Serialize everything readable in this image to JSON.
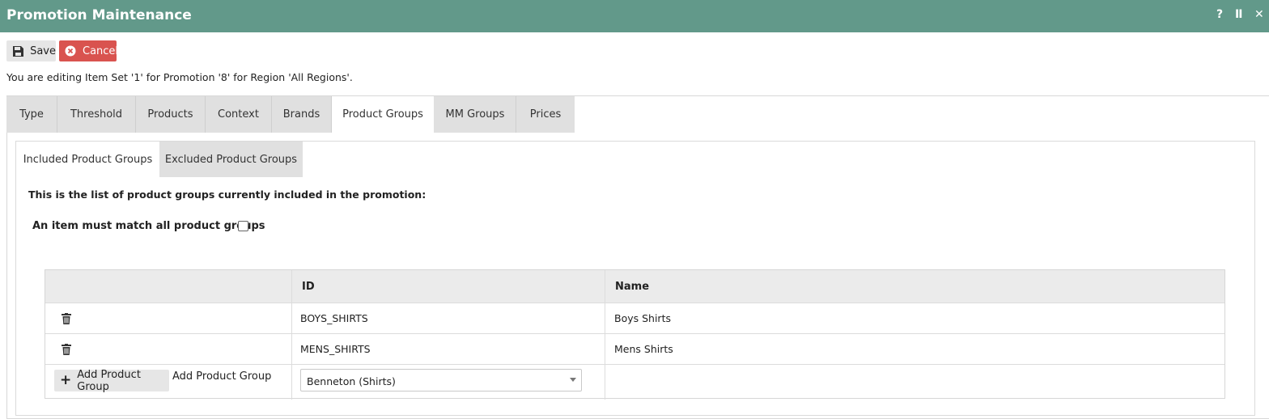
{
  "window": {
    "title": "Promotion Maintenance",
    "controls": {
      "help": "?",
      "pause": "II",
      "close": "✕"
    }
  },
  "toolbar": {
    "save_label": "Save",
    "cancel_label": "Cancel"
  },
  "info_text": "You are editing Item Set '1' for Promotion '8' for Region 'All Regions'.",
  "tabs": [
    {
      "label": "Type"
    },
    {
      "label": "Threshold"
    },
    {
      "label": "Products"
    },
    {
      "label": "Context"
    },
    {
      "label": "Brands"
    },
    {
      "label": "Product Groups",
      "active": true
    },
    {
      "label": "MM Groups"
    },
    {
      "label": "Prices"
    }
  ],
  "subtabs": [
    {
      "label": "Included Product Groups",
      "active": true
    },
    {
      "label": "Excluded Product Groups"
    }
  ],
  "description": "This is the list of product groups currently included in the promotion:",
  "match_all": {
    "label": "An item must match all product groups",
    "checked": false
  },
  "grid": {
    "columns": [
      "",
      "ID",
      "Name"
    ],
    "rows": [
      {
        "id": "BOYS_SHIRTS",
        "name": "Boys Shirts"
      },
      {
        "id": "MENS_SHIRTS",
        "name": "Mens Shirts"
      }
    ],
    "add_button_label": "Add Product Group",
    "add_label": "Add Product Group",
    "selected_group": "Benneton (Shirts)"
  },
  "colors": {
    "titlebar": "#62998a",
    "cancel": "#d9534f"
  }
}
